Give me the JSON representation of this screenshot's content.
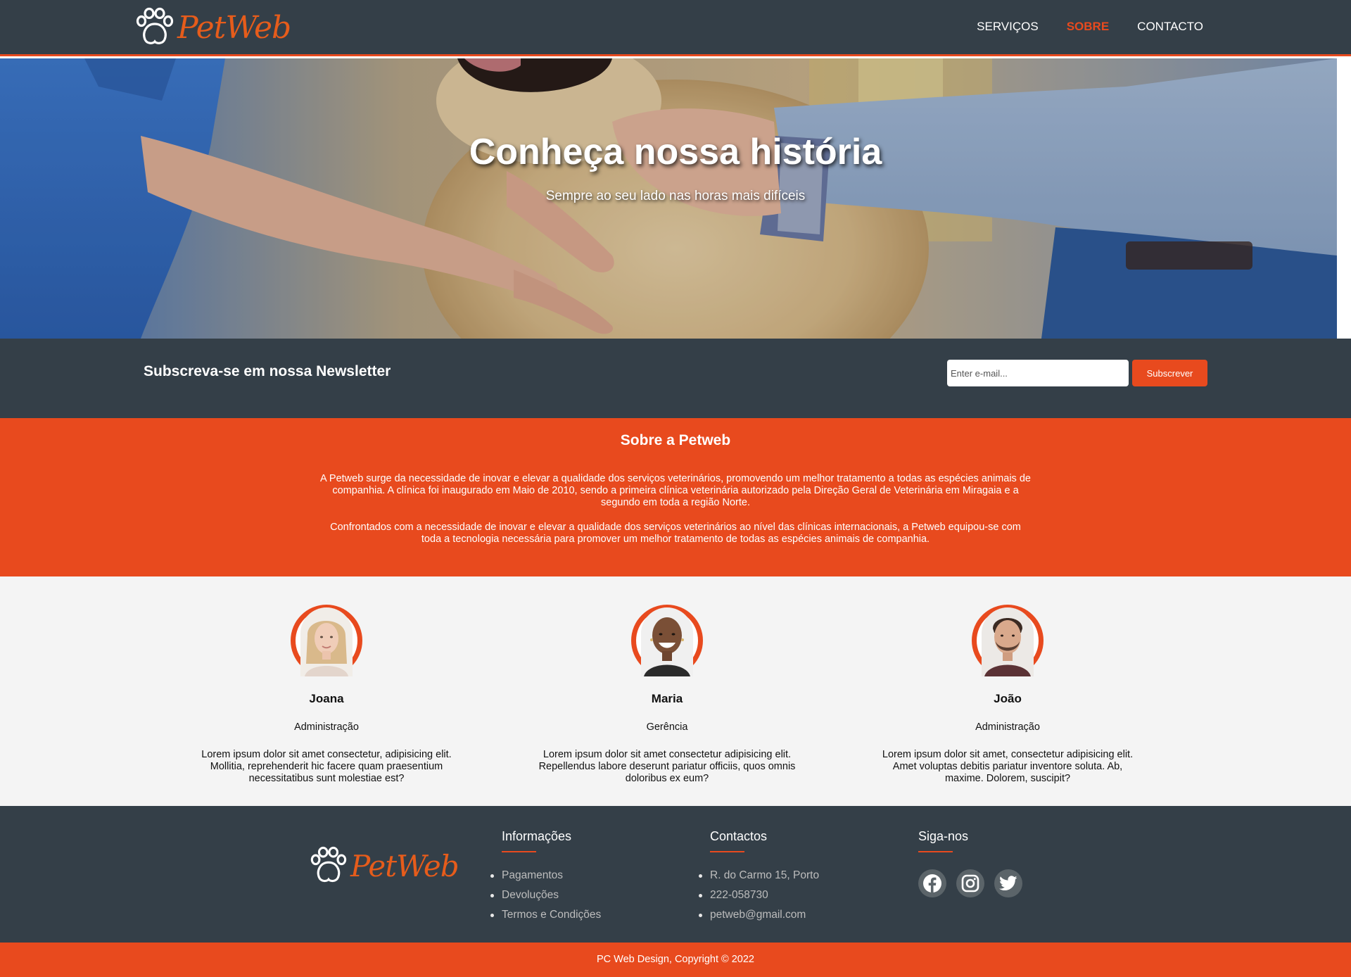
{
  "brand": {
    "logo_text": "PetWeb",
    "accent": "#e84a1e",
    "dark": "#343f48"
  },
  "nav": {
    "links": [
      {
        "label": "SERVIÇOS",
        "active": false
      },
      {
        "label": "SOBRE",
        "active": true
      },
      {
        "label": "CONTACTO",
        "active": false
      }
    ]
  },
  "hero": {
    "title": "Conheça nossa história",
    "subtitle": "Sempre ao seu lado nas horas mais difíceis"
  },
  "newsletter": {
    "heading": "Subscreva-se em nossa Newsletter",
    "placeholder": "Enter e-mail...",
    "button": "Subscrever"
  },
  "about": {
    "heading": "Sobre a Petweb",
    "paragraph1": "A Petweb surge da necessidade de inovar e elevar a qualidade dos serviços veterinários, promovendo um melhor tratamento a todas as espécies animais de companhia. A clínica foi inaugurado em Maio de 2010, sendo a primeira clínica veterinária autorizado pela Direção Geral de Veterinária em Miragaia e a segundo em toda a região Norte.",
    "paragraph2": "Confrontados com a necessidade de inovar e elevar a qualidade dos serviços veterinários ao nível das clínicas internacionais, a Petweb equipou-se com toda a tecnologia necessária para promover um melhor tratamento de todas as espécies animais de companhia."
  },
  "team": [
    {
      "name": "Joana",
      "role": "Administração",
      "description": "Lorem ipsum dolor sit amet consectetur, adipisicing elit. Mollitia, reprehenderit hic facere quam praesentium necessitatibus sunt molestiae est?"
    },
    {
      "name": "Maria",
      "role": "Gerência",
      "description": "Lorem ipsum dolor sit amet consectetur adipisicing elit. Repellendus labore deserunt pariatur officiis, quos omnis doloribus ex eum?"
    },
    {
      "name": "João",
      "role": "Administração",
      "description": "Lorem ipsum dolor sit amet, consectetur adipisicing elit. Amet voluptas debitis pariatur inventore soluta. Ab, maxime. Dolorem, suscipit?"
    }
  ],
  "footer": {
    "logo_text": "PetWeb",
    "info": {
      "heading": "Informações",
      "items": [
        "Pagamentos",
        "Devoluções",
        "Termos e Condições"
      ]
    },
    "contacts": {
      "heading": "Contactos",
      "items": [
        "R. do Carmo 15, Porto",
        "222-058730",
        "petweb@gmail.com"
      ]
    },
    "social": {
      "heading": "Siga-nos",
      "icons": [
        "facebook-icon",
        "instagram-icon",
        "twitter-icon"
      ]
    },
    "copyright": "PC Web Design, Copyright © 2022"
  }
}
